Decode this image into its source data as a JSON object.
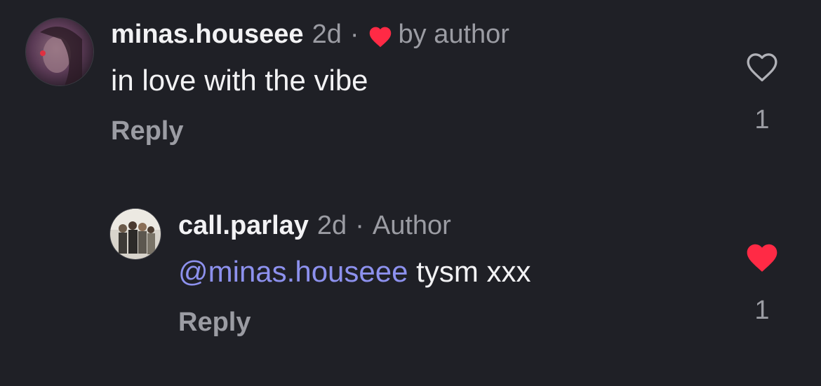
{
  "comments": [
    {
      "username": "minas.houseee",
      "time": "2d",
      "separator": "·",
      "badge": "by author",
      "text": "in love with the vibe",
      "reply_label": "Reply",
      "like_count": "1",
      "liked": false
    },
    {
      "username": "call.parlay",
      "time": "2d",
      "separator": "·",
      "badge": "Author",
      "mention": "@minas.houseee",
      "text": " tysm xxx",
      "reply_label": "Reply",
      "like_count": "1",
      "liked": true
    }
  ],
  "colors": {
    "background": "#1f2026",
    "heart_red": "#ff2a45",
    "mention": "#8d91ee",
    "muted": "#9b9ca3"
  },
  "icons": {
    "author_like": "heart-filled-icon",
    "like_outline": "heart-outline-icon",
    "like_filled": "heart-filled-icon"
  }
}
